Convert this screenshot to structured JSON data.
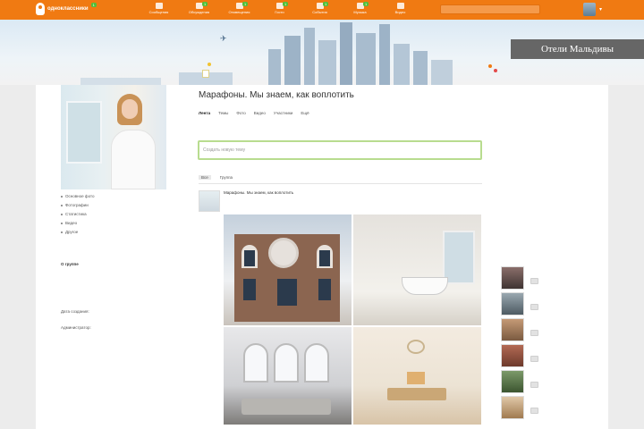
{
  "topbar": {
    "logo_text": "одноклассники",
    "logo_badge": "1",
    "nav": [
      {
        "label": "Сообщения",
        "badge": "",
        "icon": "envelope-icon"
      },
      {
        "label": "Обсуждения",
        "badge": "1",
        "icon": "chat-icon"
      },
      {
        "label": "Оповещения",
        "badge": "1",
        "icon": "bell-icon"
      },
      {
        "label": "Гости",
        "badge": "1",
        "icon": "guests-icon"
      },
      {
        "label": "События",
        "badge": "1",
        "icon": "events-icon"
      },
      {
        "label": "Музыка",
        "badge": "1",
        "icon": "music-icon"
      },
      {
        "label": "Видео",
        "badge": "",
        "icon": "video-icon"
      }
    ],
    "search_placeholder": ""
  },
  "banner": {
    "group_title": "Отели Мальдивы",
    "tag": ""
  },
  "left": {
    "mini_logo": "",
    "menu": [
      "Основное фото",
      "Фотографии",
      "Статистика",
      "Видео",
      "Другое"
    ],
    "about_header": "О группе",
    "about_text": "",
    "created_label": "Дата создания:",
    "created_value": "",
    "admin_label": "Администратор:",
    "admin_value": "",
    "contacts": []
  },
  "center": {
    "group_name": "Марафоны. Мы знаем, как воплотить",
    "tabs": [
      {
        "label": "Лента",
        "active": true
      },
      {
        "label": "Темы",
        "active": false
      },
      {
        "label": "Фото",
        "active": false
      },
      {
        "label": "Видео",
        "active": false
      },
      {
        "label": "Участники",
        "active": false
      },
      {
        "label": "Ещё",
        "active": false
      }
    ],
    "post_placeholder": "Создать новую тему",
    "feed_tabs": [
      {
        "label": "Все",
        "active": true
      },
      {
        "label": "Группа",
        "active": false
      }
    ],
    "post": {
      "author": "Марафоны. Мы знаем, как воплотить",
      "text": ""
    }
  },
  "right": {
    "friends": [
      {
        "name": ""
      },
      {
        "name": ""
      },
      {
        "name": ""
      },
      {
        "name": ""
      },
      {
        "name": ""
      },
      {
        "name": ""
      }
    ]
  },
  "colors": {
    "accent": "#f07a12",
    "green": "#4fbf3a",
    "banner_bg": "#dbe9f4"
  }
}
